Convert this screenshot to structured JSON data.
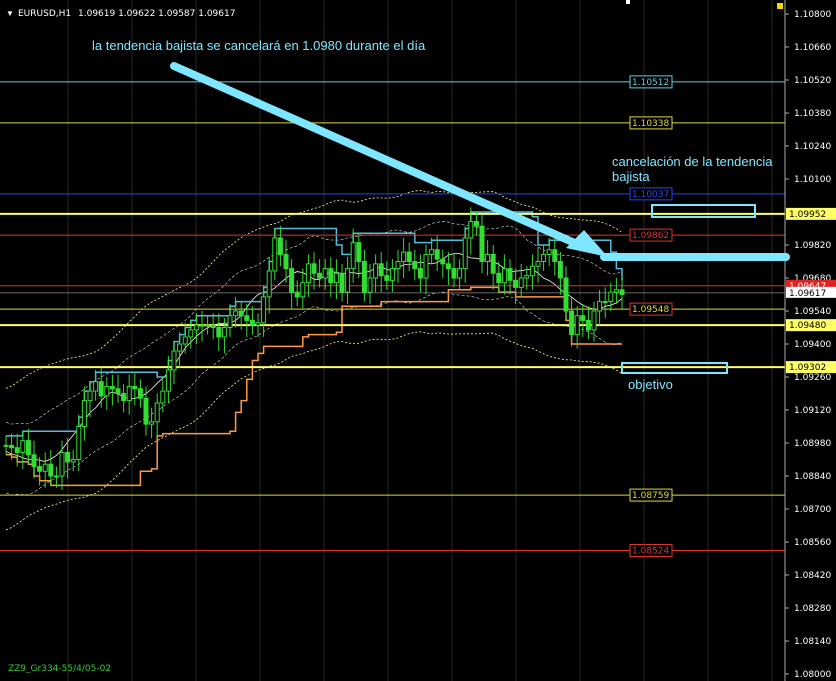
{
  "window": {
    "symbol_label": "EURUSD,H1",
    "ohlc": "1.09619 1.09622 1.09587 1.09617",
    "footer": "ZZ9_Gr334-55/4/05-02"
  },
  "annotations": {
    "headline": "la tendencia bajista se cancelará en 1.0980 durante el día",
    "cancel_line1": "cancelación de la tendencia",
    "cancel_line2": "bajista",
    "target": "objetivo"
  },
  "colors": {
    "background": "#000000",
    "grid": "#3a3a3a",
    "candle_up": "#33dd33",
    "candle_down": "#22aa22",
    "arrow": "#7fe6ff",
    "yellow": "#ffff66",
    "cyan": "#66ccdd",
    "red": "#dd3333",
    "blue": "#2244ff",
    "orange": "#ff9944"
  },
  "chart_data": {
    "type": "candlestick",
    "symbol": "EURUSD",
    "timeframe": "H1",
    "y_ticks": [
      "1.10800",
      "1.10660",
      "1.10520",
      "1.10380",
      "1.10240",
      "1.10100",
      "1.09820",
      "1.09680",
      "1.09540",
      "1.09400",
      "1.09260",
      "1.09120",
      "1.08980",
      "1.08840",
      "1.08700",
      "1.08560",
      "1.08420",
      "1.08280",
      "1.08140",
      "1.08000"
    ],
    "ylim": [
      1.08,
      1.1083
    ],
    "current_price": "1.09617",
    "current_price_value": 1.09617,
    "red_marker_price": "1.09647",
    "red_marker_value": 1.09647,
    "levels": [
      {
        "label": "1.10512",
        "value": 1.10512,
        "color": "#66ccdd",
        "box": "#66ccdd"
      },
      {
        "label": "1.10338",
        "value": 1.10338,
        "color": "#dddd33",
        "box": "#dddd33"
      },
      {
        "label": "1.10037",
        "value": 1.10037,
        "color": "#2244ff",
        "box": "#2244ff"
      },
      {
        "label": "1.09952",
        "value": 1.09952,
        "color": "#ffff66",
        "box": "#ffff66",
        "on_axis": true
      },
      {
        "label": "1.09862",
        "value": 1.09862,
        "color": "#dd3333",
        "box": "#dd3333"
      },
      {
        "label": "1.09548",
        "value": 1.09548,
        "color": "#dddd33",
        "box": "#dd3333"
      },
      {
        "label": "1.09480",
        "value": 1.0948,
        "color": "#ffff66",
        "box": "#ffff66",
        "on_axis": true
      },
      {
        "label": "1.09302",
        "value": 1.09302,
        "color": "#ffff66",
        "box": "#ffff66",
        "on_axis": true
      },
      {
        "label": "1.08759",
        "value": 1.08759,
        "color": "#dddd33",
        "box": "#dddd33"
      },
      {
        "label": "1.08524",
        "value": 1.08524,
        "color": "#dd3333",
        "box": "#dd3333"
      }
    ],
    "close_series": [
      1.0897,
      1.0896,
      1.0894,
      1.0899,
      1.0893,
      1.0888,
      1.0886,
      1.0889,
      1.0884,
      1.0884,
      1.0894,
      1.089,
      1.0891,
      1.0905,
      1.0916,
      1.092,
      1.0924,
      1.0918,
      1.0922,
      1.0921,
      1.0919,
      1.0916,
      1.0922,
      1.0921,
      1.0917,
      1.0906,
      1.0907,
      1.0915,
      1.092,
      1.0929,
      1.0937,
      1.094,
      1.0943,
      1.0946,
      1.0948,
      1.0948,
      1.0948,
      1.0947,
      1.0943,
      1.0947,
      1.0952,
      1.0954,
      1.0952,
      1.095,
      1.0948,
      1.0949,
      1.096,
      1.0971,
      1.0985,
      1.0978,
      1.0972,
      1.0962,
      1.096,
      1.0966,
      1.0974,
      1.097,
      1.0968,
      1.0972,
      1.0966,
      1.097,
      1.0962,
      1.0972,
      1.0983,
      1.0975,
      1.0962,
      1.0968,
      1.0974,
      1.0969,
      1.0967,
      1.0972,
      1.0975,
      1.0979,
      1.0975,
      1.0972,
      1.0968,
      1.0978,
      1.098,
      1.0976,
      1.0974,
      1.0972,
      1.0968,
      1.0972,
      1.0985,
      1.0992,
      1.099,
      1.0975,
      1.0978,
      1.097,
      1.0966,
      1.0972,
      1.0967,
      1.0964,
      1.0968,
      1.0969,
      1.0973,
      1.0975,
      1.0978,
      1.098,
      1.0975,
      1.0968,
      1.0954,
      1.0944,
      1.0952,
      1.095,
      1.0946,
      1.0954,
      1.0958,
      1.0958,
      1.0962,
      1.0963,
      1.0961
    ]
  }
}
